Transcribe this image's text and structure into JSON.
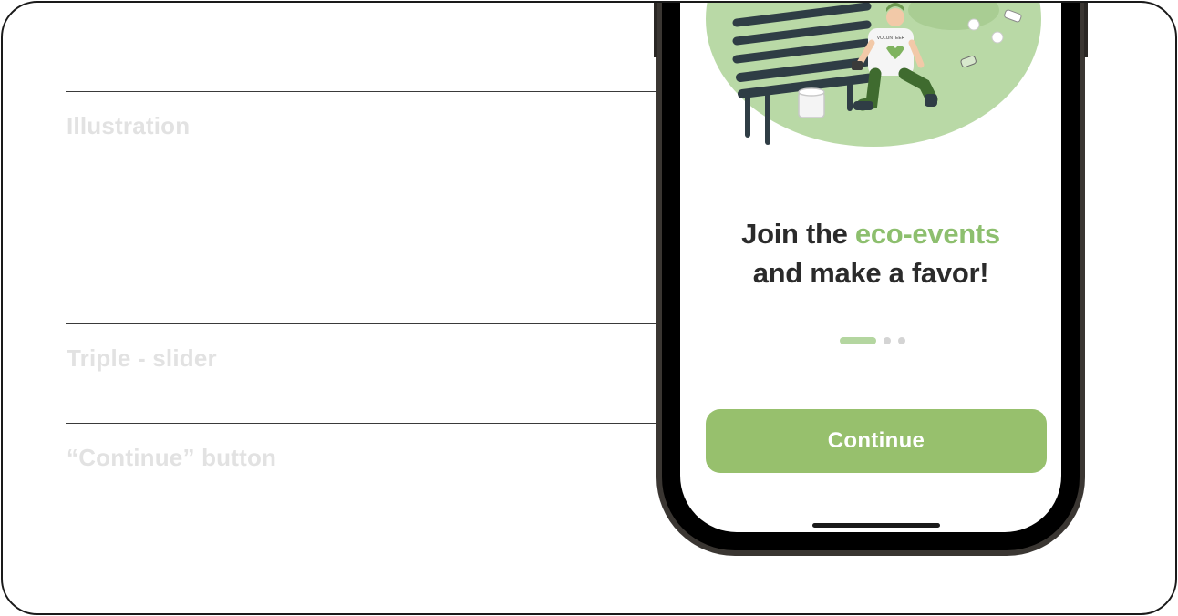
{
  "annotations": [
    {
      "label": "Illustration"
    },
    {
      "label": "Triple - slider"
    },
    {
      "label": "“Continue” button"
    }
  ],
  "screen": {
    "headline": {
      "line1_prefix": "Join the ",
      "line1_accent": "eco-events",
      "line2": "and make a favor!"
    },
    "slider": {
      "total": 3,
      "active_index": 0
    },
    "continue_label": "Continue",
    "illustration": {
      "icon": "eco-volunteer-illustration",
      "shirt_text": "VOLUNTEER"
    }
  },
  "colors": {
    "accent_green": "#8dbf6e",
    "button_green": "#97c06d",
    "slider_active": "#b4d6a0",
    "slider_inactive": "#d4d4d4",
    "headline_text": "#2b2b2b",
    "annotation_text": "#e2e2e2"
  }
}
